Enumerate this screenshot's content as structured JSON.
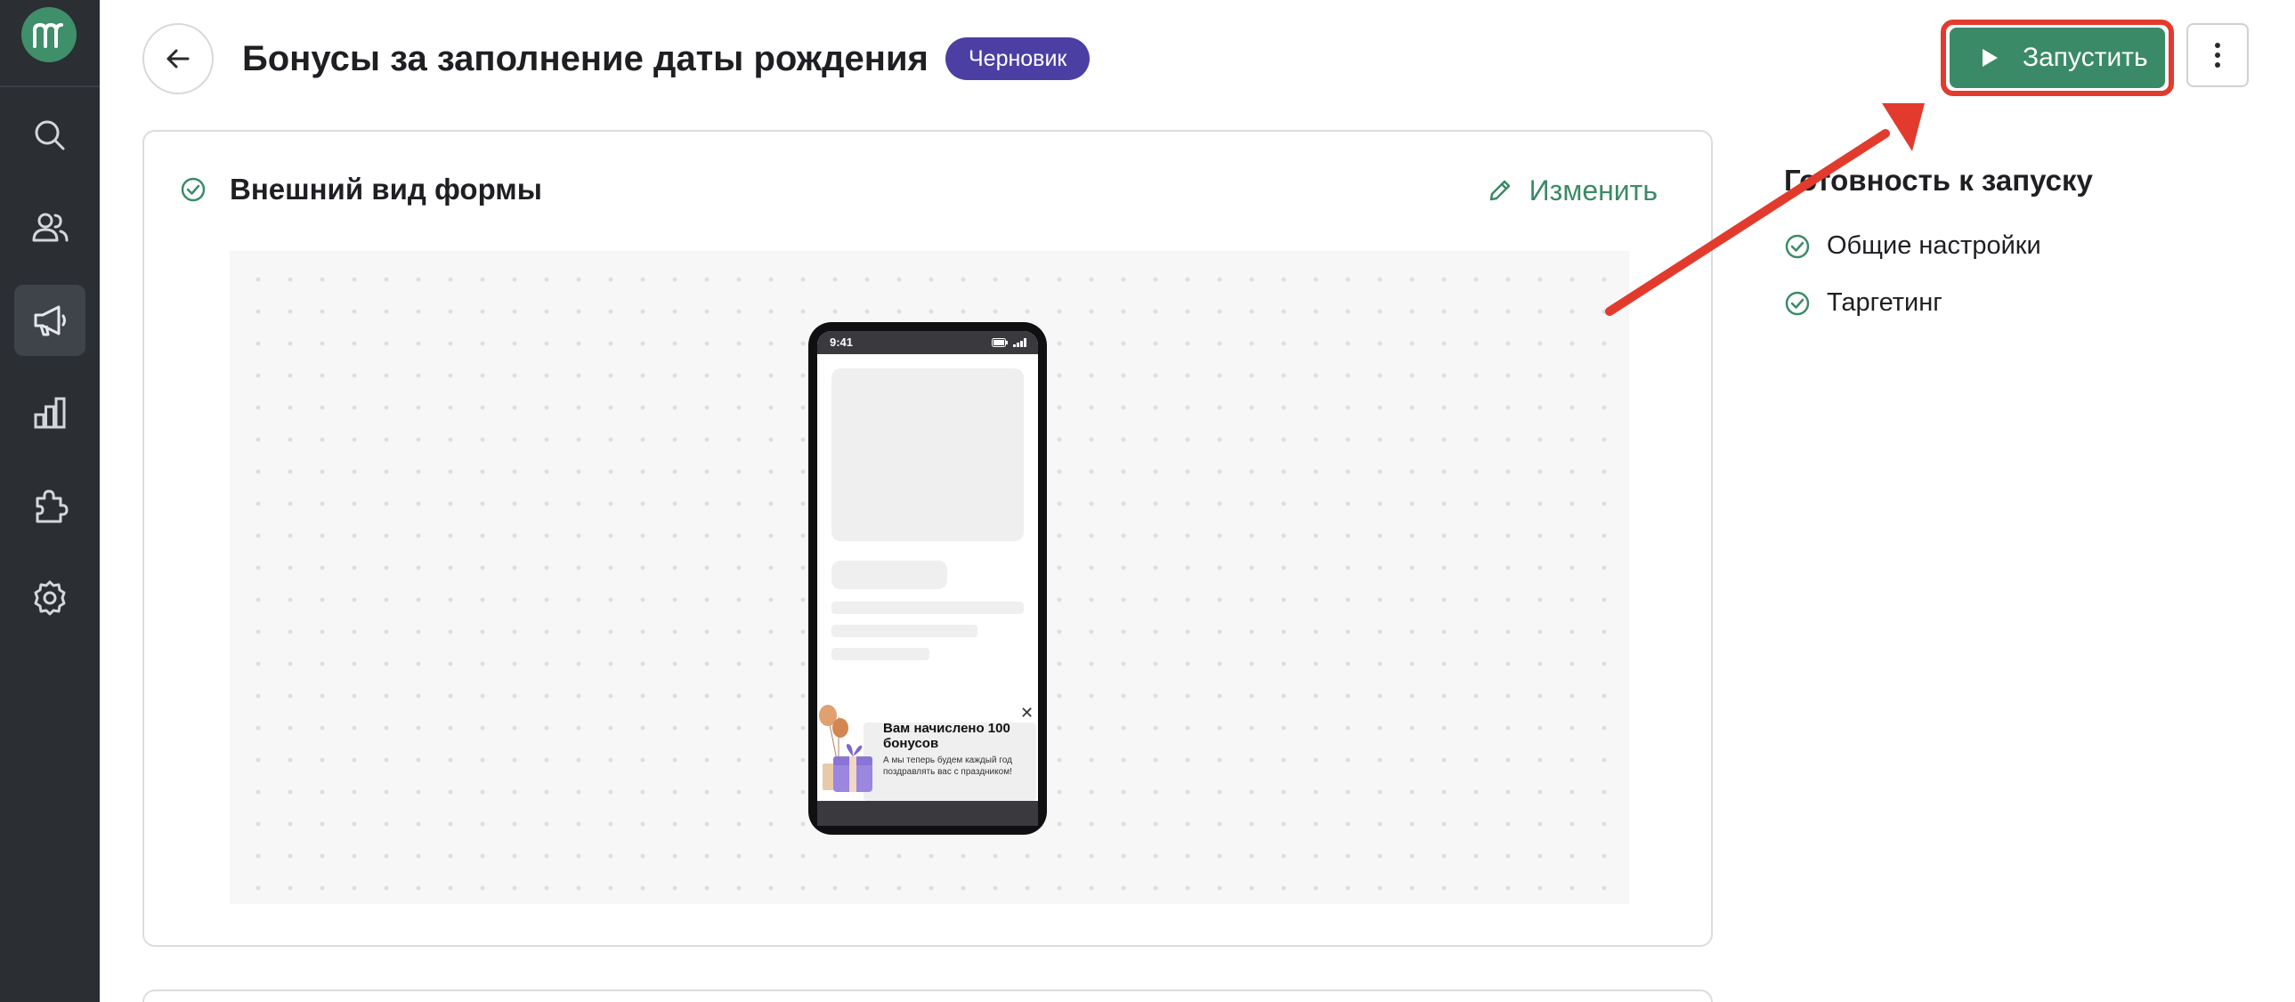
{
  "app": {
    "logo_icon": "brand-m-icon"
  },
  "sidebar": {
    "items": [
      {
        "name": "search",
        "icon": "search-icon",
        "active": false
      },
      {
        "name": "users",
        "icon": "users-icon",
        "active": false
      },
      {
        "name": "campaigns",
        "icon": "megaphone-icon",
        "active": true
      },
      {
        "name": "analytics",
        "icon": "bar-chart-icon",
        "active": false
      },
      {
        "name": "integrations",
        "icon": "puzzle-icon",
        "active": false
      },
      {
        "name": "settings",
        "icon": "gear-icon",
        "active": false
      }
    ]
  },
  "header": {
    "title": "Бонусы за заполнение даты рождения",
    "status": "Черновик",
    "launch_label": "Запустить"
  },
  "form_card": {
    "title": "Внешний вид формы",
    "edit_label": "Изменить",
    "phone": {
      "time": "9:41",
      "popup_title": "Вам начислено 100 бонусов",
      "popup_text": "А мы теперь будем каждый год поздравлять вас с праздником!"
    }
  },
  "readiness": {
    "title": "Готовность к запуску",
    "items": [
      {
        "label": "Общие настройки",
        "done": true
      },
      {
        "label": "Таргетинг",
        "done": true
      }
    ]
  },
  "colors": {
    "sidebar_bg": "#2b2e33",
    "accent_green": "#3b8a67",
    "status_purple": "#4b3fa3",
    "annotation_red": "#e23b2d"
  }
}
